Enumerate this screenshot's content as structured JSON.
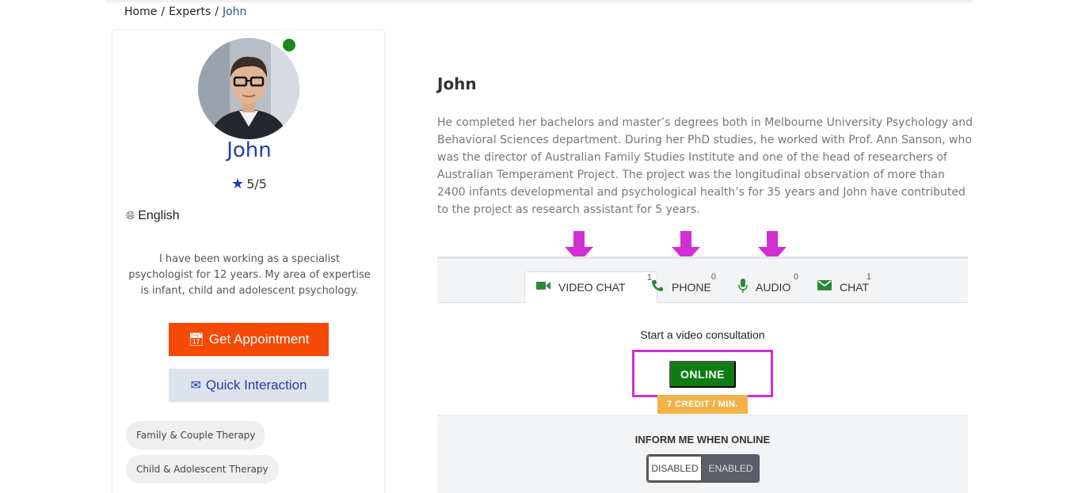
{
  "breadcrumb": {
    "home": "Home",
    "experts": "Experts",
    "current": "John",
    "separator": "/"
  },
  "profile": {
    "name": "John",
    "rating": "5/5",
    "language": "English",
    "bio": "I have been working as a specialist psychologist for 12 years. My area of expertise is infant, child and adolescent psychology.",
    "appointment_label": "Get Appointment",
    "quick_label": "Quick Interaction",
    "tags": [
      "Family & Couple Therapy",
      "Child & Adolescent Therapy"
    ],
    "status_color": "#1a8a1a"
  },
  "details": {
    "name": "John",
    "description": "He completed her bachelors and master’s degrees both in Melbourne University Psychology and Behavioral Sciences department. During her PhD studies, he worked with Prof. Ann Sanson, who was the director of Australian Family Studies Institute and one of the head of researchers of Australian Temperament Project. The project was the longitudinal observation of more than 2400 infants developmental and psychological health’s for 35 years and John have contributed to the project as research assistant for 5 years."
  },
  "channels": {
    "tabs": [
      {
        "label": "VIDEO CHAT",
        "count": "1",
        "icon": "video-camera-icon"
      },
      {
        "label": "PHONE",
        "count": "0",
        "icon": "phone-icon"
      },
      {
        "label": "AUDIO",
        "count": "0",
        "icon": "microphone-icon"
      },
      {
        "label": "CHAT",
        "count": "1",
        "icon": "envelope-icon"
      }
    ],
    "start_text": "Start a video consultation",
    "online_label": "ONLINE",
    "credit_label": "7 CREDIT / MIN.",
    "inform_label": "INFORM ME WHEN ONLINE",
    "toggle_off": "DISABLED",
    "toggle_on": "ENABLED"
  },
  "colors": {
    "accent_blue": "#1f3fa8",
    "appointment_orange": "#f54a06",
    "online_green": "#0e7d14",
    "credit_amber": "#f1b349",
    "annotation_magenta": "#d12fd4"
  }
}
